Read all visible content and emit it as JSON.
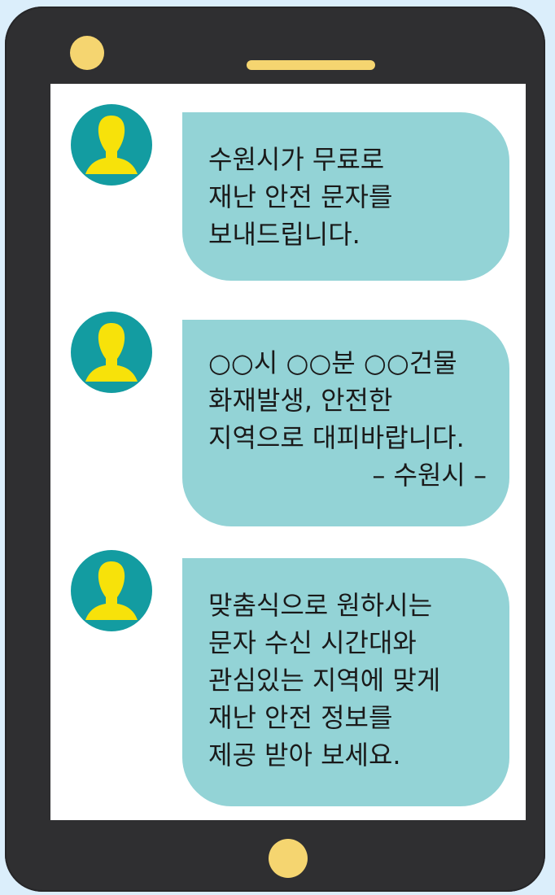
{
  "colors": {
    "background": "#dbeefb",
    "phone_body": "#2f2f31",
    "accent_yellow": "#f5d570",
    "screen": "#ffffff",
    "avatar_bg": "#139ca1",
    "avatar_figure": "#f7e20a",
    "bubble": "#93d3d6",
    "text": "#1a1a1a"
  },
  "icons": {
    "avatar": "person-silhouette-icon"
  },
  "messages": [
    {
      "lines": [
        "수원시가 무료로",
        "재난 안전 문자를",
        "보내드립니다."
      ]
    },
    {
      "lines": [
        "○○시 ○○분 ○○건물",
        "화재발생, 안전한",
        "지역으로 대피바랍니다."
      ],
      "signature": "– 수원시 –"
    },
    {
      "lines": [
        "맞춤식으로 원하시는",
        "문자 수신 시간대와",
        "관심있는 지역에 맞게",
        "재난 안전 정보를",
        "제공 받아 보세요."
      ]
    }
  ]
}
